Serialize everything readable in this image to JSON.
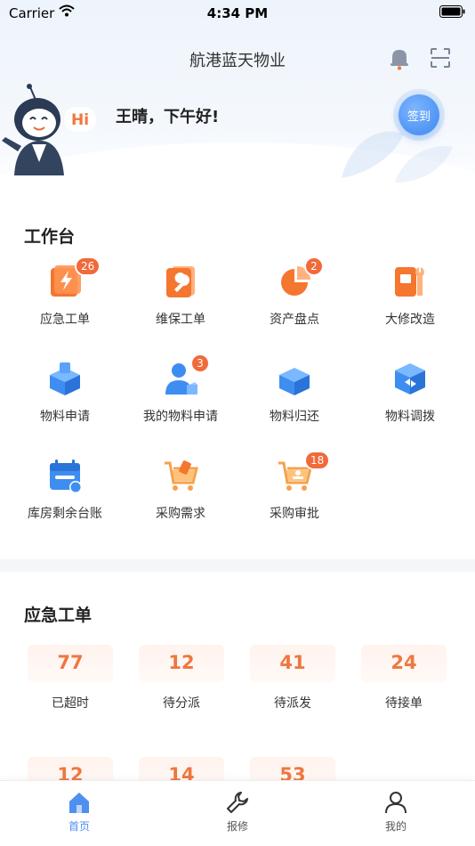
{
  "status_bar": {
    "carrier": "Carrier",
    "time": "4:34 PM"
  },
  "header": {
    "title": "航港蓝天物业",
    "greeting": "王晴，下午好!",
    "signin_label": "签到",
    "mascot_text": "Hi"
  },
  "workbench": {
    "title": "工作台",
    "items": [
      {
        "label": "应急工单",
        "badge": "26",
        "icon": "emergency-order-icon"
      },
      {
        "label": "维保工单",
        "badge": "",
        "icon": "maintenance-order-icon"
      },
      {
        "label": "资产盘点",
        "badge": "2",
        "icon": "asset-inventory-icon"
      },
      {
        "label": "大修改造",
        "badge": "",
        "icon": "overhaul-icon"
      },
      {
        "label": "物料申请",
        "badge": "",
        "icon": "material-request-icon"
      },
      {
        "label": "我的物料申请",
        "badge": "3",
        "icon": "my-material-request-icon"
      },
      {
        "label": "物料归还",
        "badge": "",
        "icon": "material-return-icon"
      },
      {
        "label": "物料调拨",
        "badge": "",
        "icon": "material-transfer-icon"
      },
      {
        "label": "库房剩余台账",
        "badge": "",
        "icon": "warehouse-ledger-icon"
      },
      {
        "label": "采购需求",
        "badge": "",
        "icon": "purchase-demand-icon"
      },
      {
        "label": "采购审批",
        "badge": "18",
        "icon": "purchase-approval-icon"
      }
    ]
  },
  "emergency": {
    "title": "应急工单",
    "stats": [
      {
        "value": "77",
        "label": "已超时"
      },
      {
        "value": "12",
        "label": "待分派"
      },
      {
        "value": "41",
        "label": "待派发"
      },
      {
        "value": "24",
        "label": "待接单"
      },
      {
        "value": "12",
        "label": ""
      },
      {
        "value": "14",
        "label": ""
      },
      {
        "value": "53",
        "label": ""
      }
    ]
  },
  "tab_bar": {
    "items": [
      {
        "label": "首页",
        "icon": "home-icon",
        "active": true
      },
      {
        "label": "报修",
        "icon": "wrench-icon",
        "active": false
      },
      {
        "label": "我的",
        "icon": "person-icon",
        "active": false
      }
    ]
  },
  "colors": {
    "accent": "#4f8ff0",
    "badge": "#f06a3a",
    "stat_value": "#f0773f",
    "icon_orange": "#f5762f",
    "icon_blue": "#3d8ef0"
  }
}
